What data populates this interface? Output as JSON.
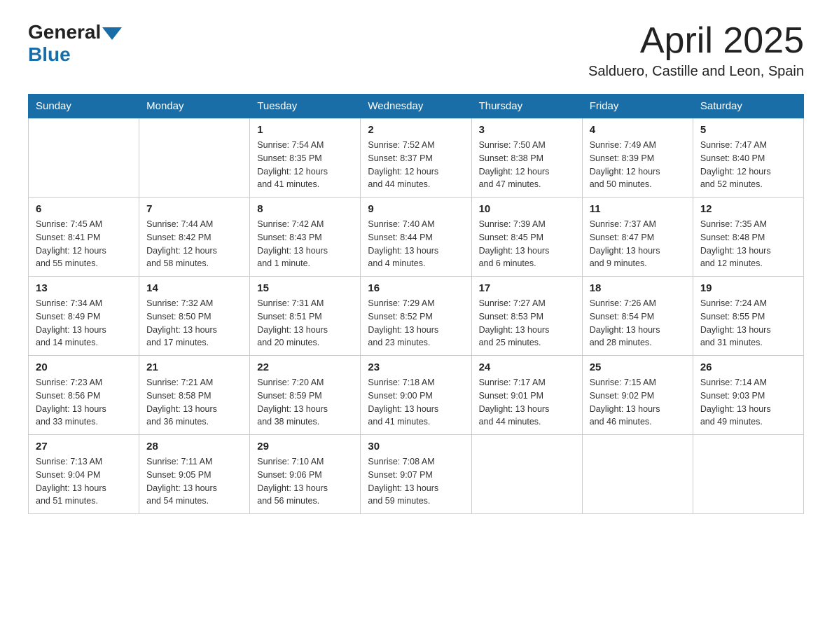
{
  "header": {
    "logo_general": "General",
    "logo_blue": "Blue",
    "month_title": "April 2025",
    "location": "Salduero, Castille and Leon, Spain"
  },
  "weekdays": [
    "Sunday",
    "Monday",
    "Tuesday",
    "Wednesday",
    "Thursday",
    "Friday",
    "Saturday"
  ],
  "weeks": [
    [
      {
        "day": "",
        "info": ""
      },
      {
        "day": "",
        "info": ""
      },
      {
        "day": "1",
        "info": "Sunrise: 7:54 AM\nSunset: 8:35 PM\nDaylight: 12 hours\nand 41 minutes."
      },
      {
        "day": "2",
        "info": "Sunrise: 7:52 AM\nSunset: 8:37 PM\nDaylight: 12 hours\nand 44 minutes."
      },
      {
        "day": "3",
        "info": "Sunrise: 7:50 AM\nSunset: 8:38 PM\nDaylight: 12 hours\nand 47 minutes."
      },
      {
        "day": "4",
        "info": "Sunrise: 7:49 AM\nSunset: 8:39 PM\nDaylight: 12 hours\nand 50 minutes."
      },
      {
        "day": "5",
        "info": "Sunrise: 7:47 AM\nSunset: 8:40 PM\nDaylight: 12 hours\nand 52 minutes."
      }
    ],
    [
      {
        "day": "6",
        "info": "Sunrise: 7:45 AM\nSunset: 8:41 PM\nDaylight: 12 hours\nand 55 minutes."
      },
      {
        "day": "7",
        "info": "Sunrise: 7:44 AM\nSunset: 8:42 PM\nDaylight: 12 hours\nand 58 minutes."
      },
      {
        "day": "8",
        "info": "Sunrise: 7:42 AM\nSunset: 8:43 PM\nDaylight: 13 hours\nand 1 minute."
      },
      {
        "day": "9",
        "info": "Sunrise: 7:40 AM\nSunset: 8:44 PM\nDaylight: 13 hours\nand 4 minutes."
      },
      {
        "day": "10",
        "info": "Sunrise: 7:39 AM\nSunset: 8:45 PM\nDaylight: 13 hours\nand 6 minutes."
      },
      {
        "day": "11",
        "info": "Sunrise: 7:37 AM\nSunset: 8:47 PM\nDaylight: 13 hours\nand 9 minutes."
      },
      {
        "day": "12",
        "info": "Sunrise: 7:35 AM\nSunset: 8:48 PM\nDaylight: 13 hours\nand 12 minutes."
      }
    ],
    [
      {
        "day": "13",
        "info": "Sunrise: 7:34 AM\nSunset: 8:49 PM\nDaylight: 13 hours\nand 14 minutes."
      },
      {
        "day": "14",
        "info": "Sunrise: 7:32 AM\nSunset: 8:50 PM\nDaylight: 13 hours\nand 17 minutes."
      },
      {
        "day": "15",
        "info": "Sunrise: 7:31 AM\nSunset: 8:51 PM\nDaylight: 13 hours\nand 20 minutes."
      },
      {
        "day": "16",
        "info": "Sunrise: 7:29 AM\nSunset: 8:52 PM\nDaylight: 13 hours\nand 23 minutes."
      },
      {
        "day": "17",
        "info": "Sunrise: 7:27 AM\nSunset: 8:53 PM\nDaylight: 13 hours\nand 25 minutes."
      },
      {
        "day": "18",
        "info": "Sunrise: 7:26 AM\nSunset: 8:54 PM\nDaylight: 13 hours\nand 28 minutes."
      },
      {
        "day": "19",
        "info": "Sunrise: 7:24 AM\nSunset: 8:55 PM\nDaylight: 13 hours\nand 31 minutes."
      }
    ],
    [
      {
        "day": "20",
        "info": "Sunrise: 7:23 AM\nSunset: 8:56 PM\nDaylight: 13 hours\nand 33 minutes."
      },
      {
        "day": "21",
        "info": "Sunrise: 7:21 AM\nSunset: 8:58 PM\nDaylight: 13 hours\nand 36 minutes."
      },
      {
        "day": "22",
        "info": "Sunrise: 7:20 AM\nSunset: 8:59 PM\nDaylight: 13 hours\nand 38 minutes."
      },
      {
        "day": "23",
        "info": "Sunrise: 7:18 AM\nSunset: 9:00 PM\nDaylight: 13 hours\nand 41 minutes."
      },
      {
        "day": "24",
        "info": "Sunrise: 7:17 AM\nSunset: 9:01 PM\nDaylight: 13 hours\nand 44 minutes."
      },
      {
        "day": "25",
        "info": "Sunrise: 7:15 AM\nSunset: 9:02 PM\nDaylight: 13 hours\nand 46 minutes."
      },
      {
        "day": "26",
        "info": "Sunrise: 7:14 AM\nSunset: 9:03 PM\nDaylight: 13 hours\nand 49 minutes."
      }
    ],
    [
      {
        "day": "27",
        "info": "Sunrise: 7:13 AM\nSunset: 9:04 PM\nDaylight: 13 hours\nand 51 minutes."
      },
      {
        "day": "28",
        "info": "Sunrise: 7:11 AM\nSunset: 9:05 PM\nDaylight: 13 hours\nand 54 minutes."
      },
      {
        "day": "29",
        "info": "Sunrise: 7:10 AM\nSunset: 9:06 PM\nDaylight: 13 hours\nand 56 minutes."
      },
      {
        "day": "30",
        "info": "Sunrise: 7:08 AM\nSunset: 9:07 PM\nDaylight: 13 hours\nand 59 minutes."
      },
      {
        "day": "",
        "info": ""
      },
      {
        "day": "",
        "info": ""
      },
      {
        "day": "",
        "info": ""
      }
    ]
  ]
}
